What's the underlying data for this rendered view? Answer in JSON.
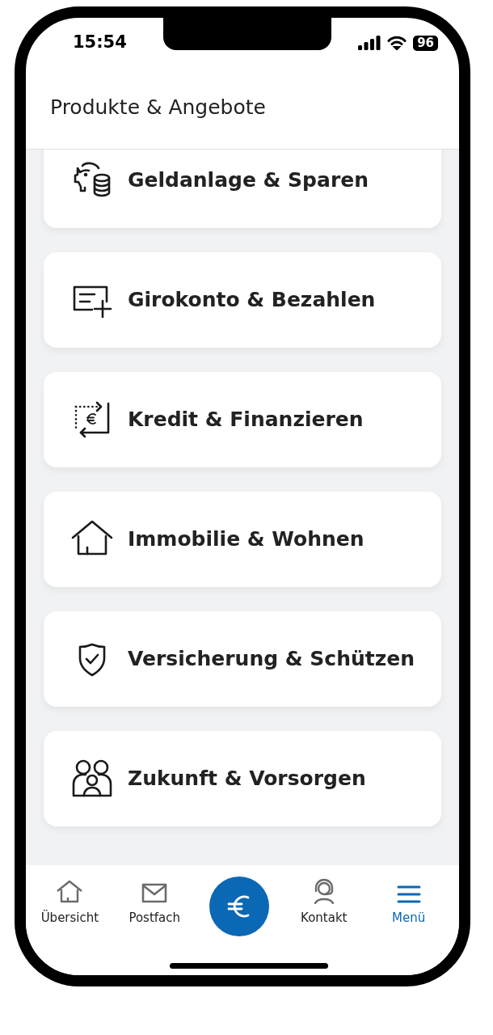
{
  "status_bar": {
    "time": "15:54",
    "battery": "96"
  },
  "header": {
    "title": "Produkte & Angebote"
  },
  "categories": [
    {
      "label": "Geldanlage & Sparen"
    },
    {
      "label": "Girokonto & Bezahlen"
    },
    {
      "label": "Kredit & Finanzieren"
    },
    {
      "label": "Immobilie & Wohnen"
    },
    {
      "label": "Versicherung & Schützen"
    },
    {
      "label": "Zukunft & Vorsorgen"
    }
  ],
  "bottom_nav": [
    {
      "label": "Übersicht",
      "selected": false
    },
    {
      "label": "Postfach",
      "selected": false
    },
    {
      "label": "Kontakt",
      "selected": false
    },
    {
      "label": "Menü",
      "selected": true
    }
  ]
}
